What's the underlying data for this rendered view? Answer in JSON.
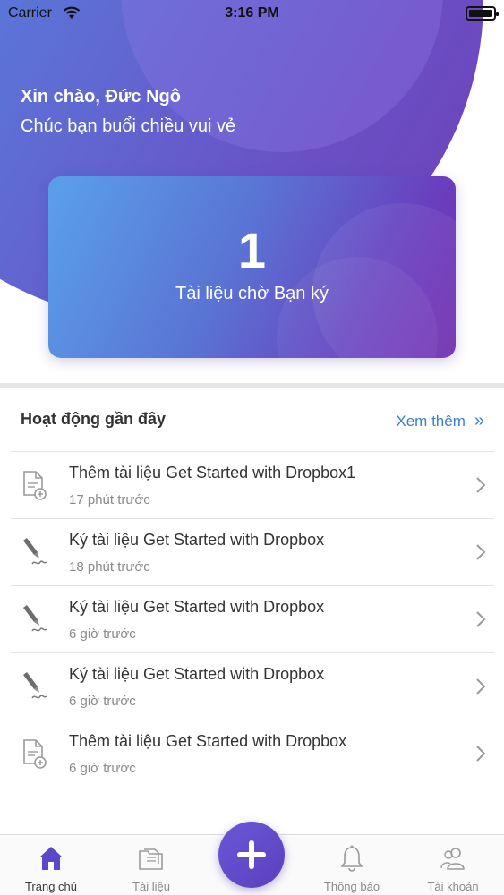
{
  "status_bar": {
    "carrier": "Carrier",
    "time": "3:16 PM"
  },
  "greeting": {
    "name": "Xin chào, Đức Ngô",
    "subtitle": "Chúc bạn buổi chiều vui vẻ"
  },
  "pending": {
    "count": "1",
    "label": "Tài liệu chờ Bạn ký"
  },
  "recent": {
    "title": "Hoạt động gần đây",
    "see_more": "Xem thêm",
    "items": [
      {
        "icon": "document-add-icon",
        "title": "Thêm tài liệu Get Started with Dropbox1",
        "time": "17 phút trước"
      },
      {
        "icon": "pen-sign-icon",
        "title": "Ký tài liệu Get Started with Dropbox",
        "time": "18 phút trước"
      },
      {
        "icon": "pen-sign-icon",
        "title": "Ký tài liệu Get Started with Dropbox",
        "time": "6 giờ trước"
      },
      {
        "icon": "pen-sign-icon",
        "title": "Ký tài liệu Get Started with Dropbox",
        "time": "6 giờ trước"
      },
      {
        "icon": "document-add-icon",
        "title": "Thêm tài liệu Get Started with Dropbox",
        "time": "6 giờ trước"
      }
    ]
  },
  "tabs": [
    {
      "label": "Trang chủ",
      "icon": "home-icon",
      "active": true
    },
    {
      "label": "Tài liệu",
      "icon": "folder-icon",
      "active": false
    },
    {
      "label": "Thông báo",
      "icon": "bell-icon",
      "active": false
    },
    {
      "label": "Tài khoản",
      "icon": "users-icon",
      "active": false
    }
  ],
  "colors": {
    "accent": "#3a7fc4",
    "brand_purple": "#6a4fc4",
    "brand_blue": "#4f8fe6"
  }
}
